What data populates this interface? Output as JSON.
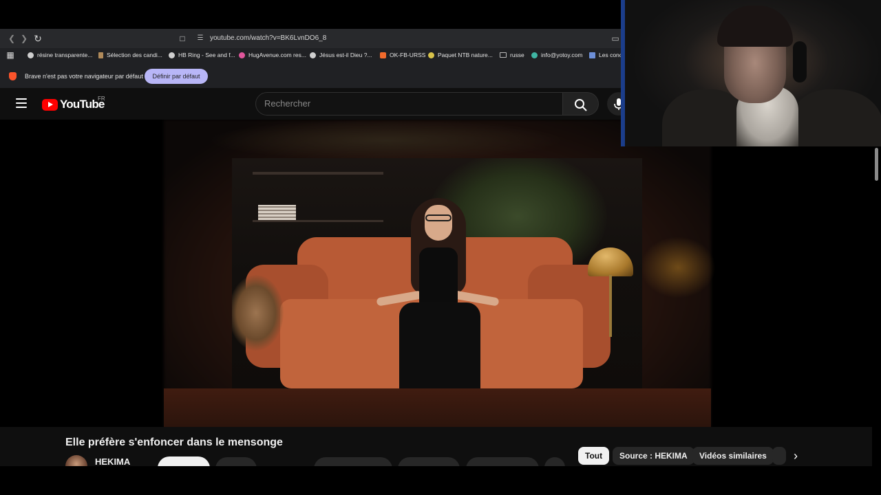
{
  "browser": {
    "url": "youtube.com/watch?v=BK6LvnDO6_8",
    "bookmarks": [
      {
        "label": "résine transparente...",
        "color": "#cfcfcf"
      },
      {
        "label": "Sélection des candi...",
        "color": "#b08a5a"
      },
      {
        "label": "HB Ring - See and f...",
        "color": "#cfcfcf"
      },
      {
        "label": "HugAvenue.com res...",
        "color": "#e0569b"
      },
      {
        "label": "Jésus est-il Dieu ?...",
        "color": "#cfcfcf"
      },
      {
        "label": "OK-FB-URSS",
        "color": "#f26b2c"
      },
      {
        "label": "Paquet NTB nature...",
        "color": "#d8c24a"
      },
      {
        "label": "russe",
        "color": "#9a9a9a"
      },
      {
        "label": "info@yotoy.com",
        "color": "#3fb5a3"
      },
      {
        "label": "Les conc",
        "color": "#6d8fd8"
      }
    ],
    "infobar": {
      "message": "Brave n'est pas votre navigateur par défaut",
      "button": "Définir par défaut"
    }
  },
  "youtube": {
    "logo_text": "YouTube",
    "country": "FR",
    "search_placeholder": "Rechercher",
    "video_title": "Elle préfère s'enfoncer dans le mensonge",
    "channel_name": "HEKIMA",
    "chips": [
      "Tout",
      "Source : HEKIMA",
      "Vidéos similaires"
    ],
    "accent": "#ff0000"
  }
}
